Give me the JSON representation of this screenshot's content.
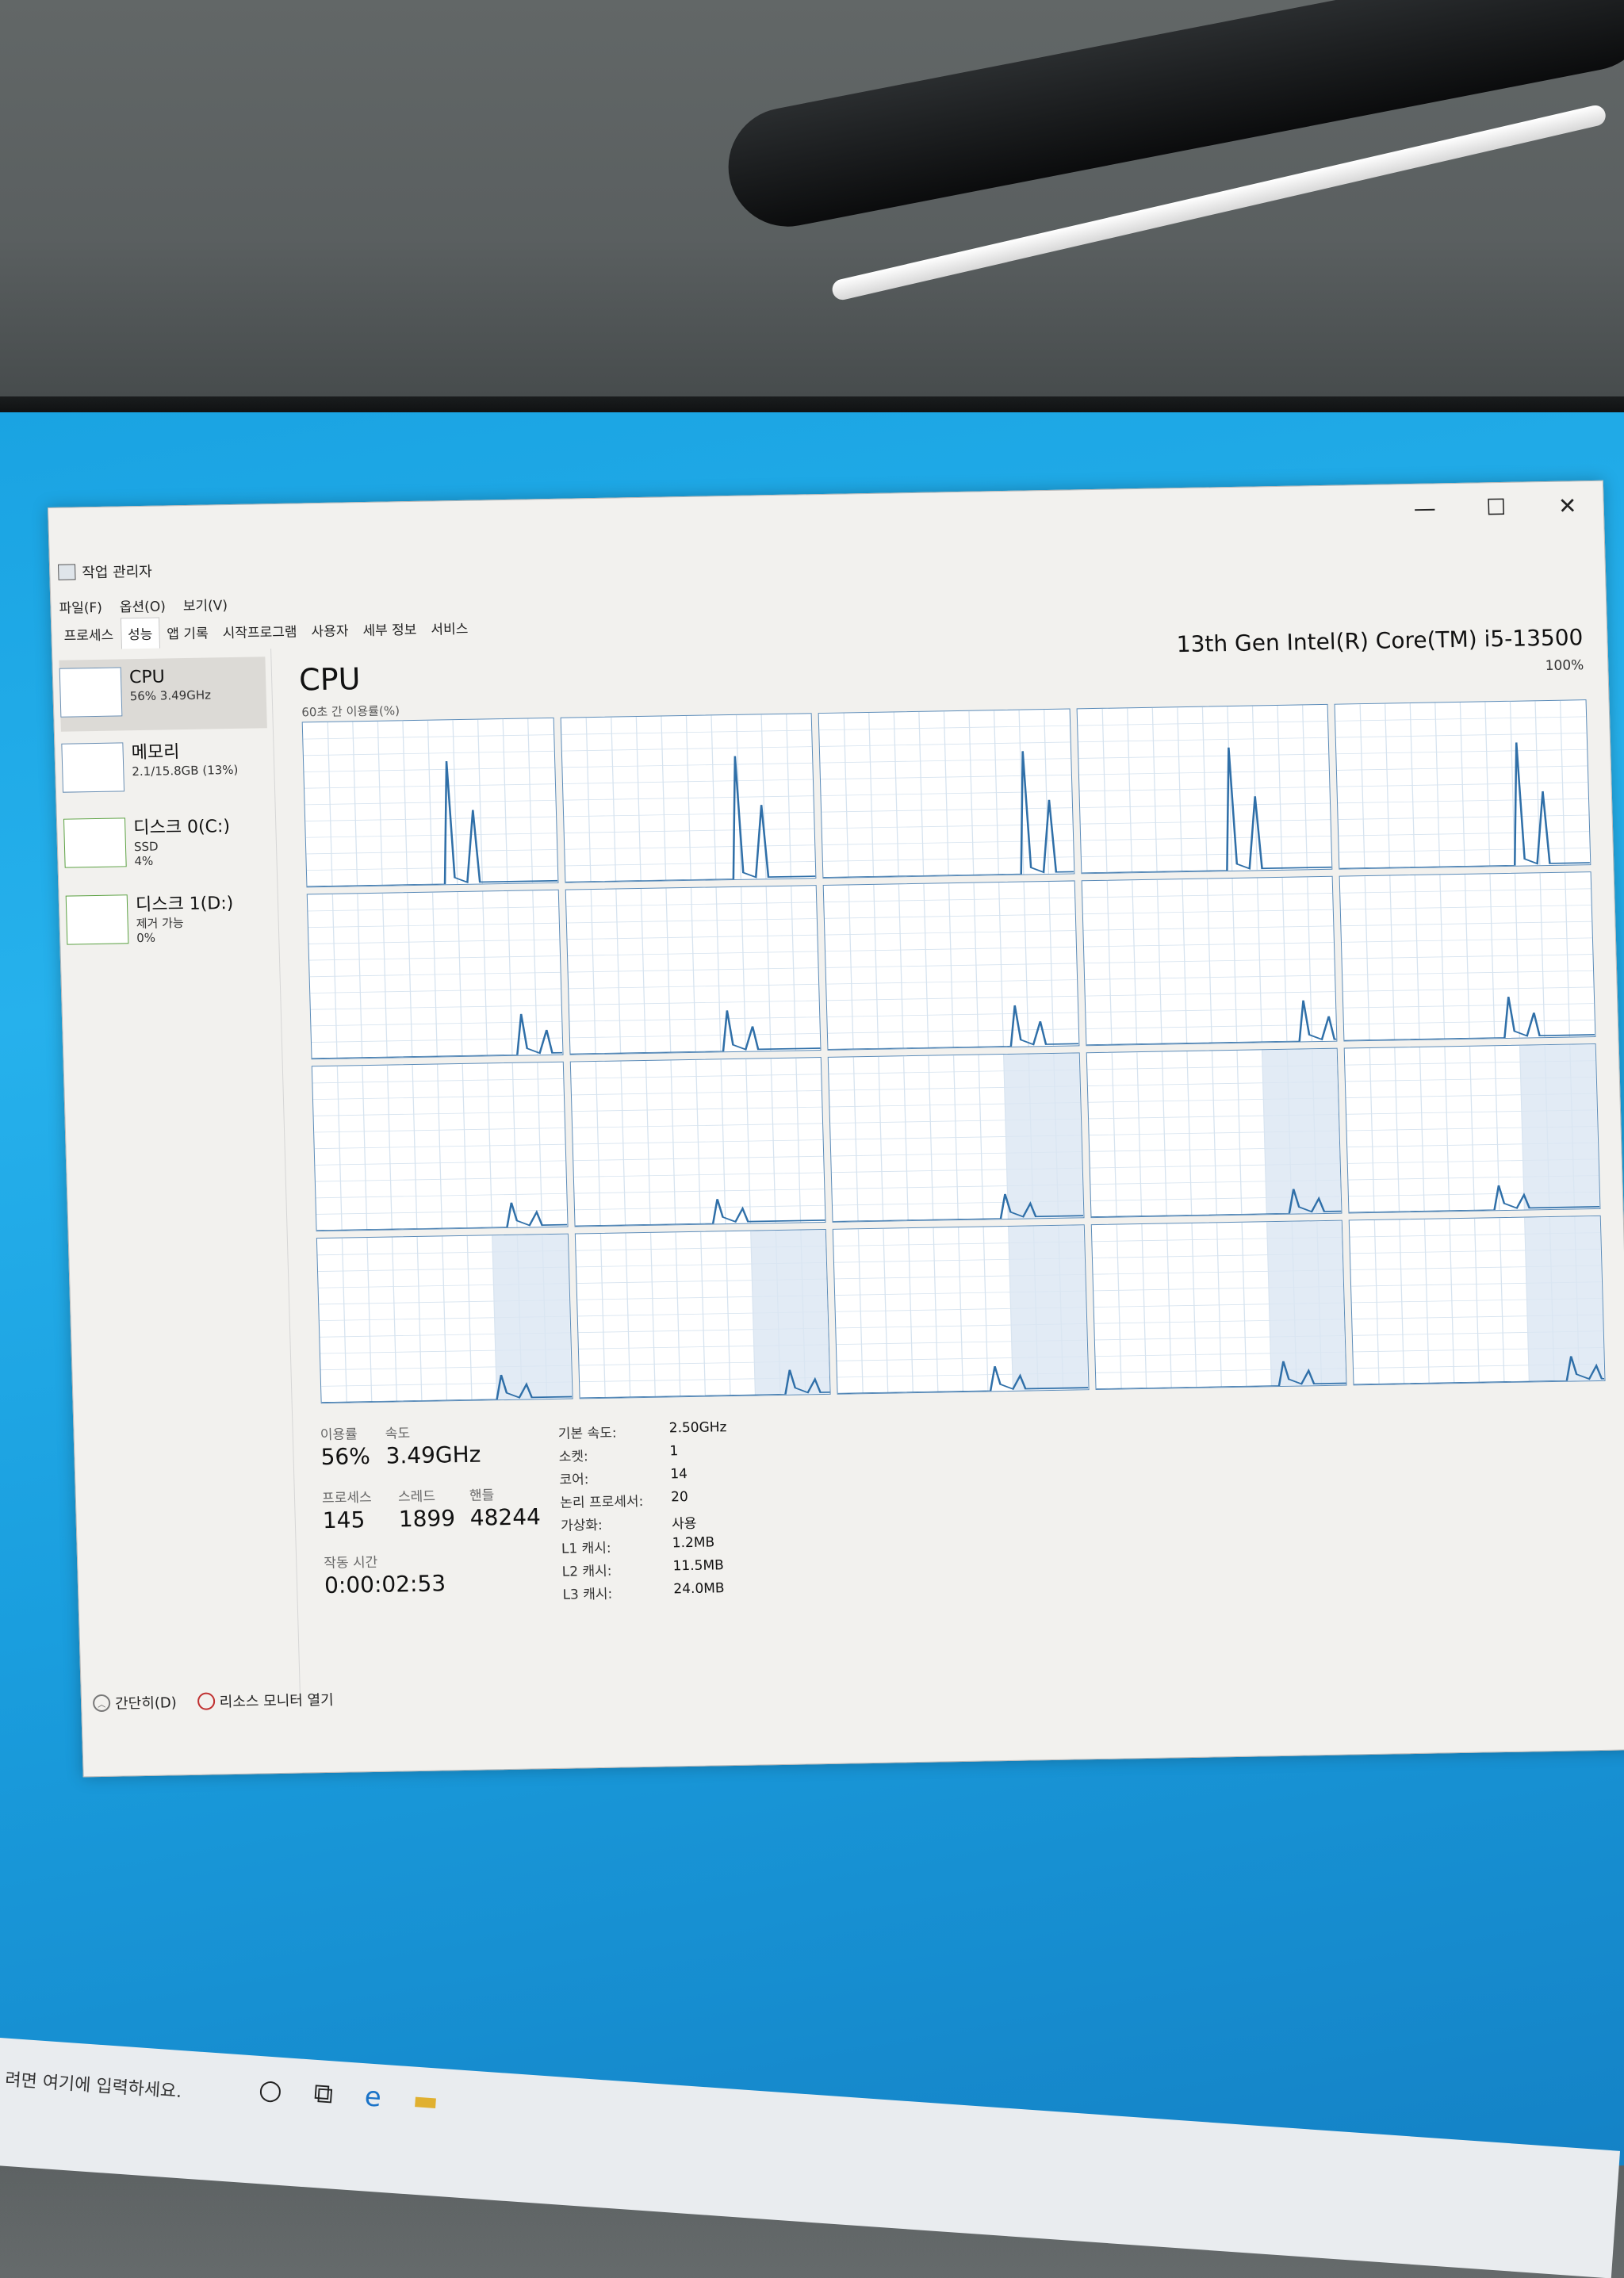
{
  "window": {
    "title": "작업 관리자",
    "controls": {
      "minimize": "—",
      "maximize": "☐",
      "close": "✕"
    }
  },
  "menu": [
    "파일(F)",
    "옵션(O)",
    "보기(V)"
  ],
  "tabs": [
    "프로세스",
    "성능",
    "앱 기록",
    "시작프로그램",
    "사용자",
    "세부 정보",
    "서비스"
  ],
  "active_tab": "성능",
  "sidebar": {
    "items": [
      {
        "name": "CPU",
        "sub1": "56% 3.49GHz",
        "sub2": "",
        "sub3": ""
      },
      {
        "name": "메모리",
        "sub1": "2.1/15.8GB (13%)",
        "sub2": "",
        "sub3": ""
      },
      {
        "name": "디스크 0(C:)",
        "sub1": "SSD",
        "sub2": "4%",
        "sub3": ""
      },
      {
        "name": "디스크 1(D:)",
        "sub1": "제거 가능",
        "sub2": "0%",
        "sub3": ""
      }
    ]
  },
  "main": {
    "title": "CPU",
    "model": "13th Gen Intel(R) Core(TM) i5-13500",
    "max_label": "100%",
    "util_label": "60초 간 이용률(%)",
    "logical_processor_graphs": 20
  },
  "stats": {
    "util_label": "이용률",
    "util_value": "56%",
    "speed_label": "속도",
    "speed_value": "3.49GHz",
    "proc_label": "프로세스",
    "proc_value": "145",
    "thread_label": "스레드",
    "thread_value": "1899",
    "handle_label": "핸들",
    "handle_value": "48244",
    "uptime_label": "작동 시간",
    "uptime_value": "0:00:02:53",
    "details": [
      {
        "k": "기본 속도:",
        "v": "2.50GHz"
      },
      {
        "k": "소켓:",
        "v": "1"
      },
      {
        "k": "코어:",
        "v": "14"
      },
      {
        "k": "논리 프로세서:",
        "v": "20"
      },
      {
        "k": "가상화:",
        "v": "사용"
      },
      {
        "k": "L1 캐시:",
        "v": "1.2MB"
      },
      {
        "k": "L2 캐시:",
        "v": "11.5MB"
      },
      {
        "k": "L3 캐시:",
        "v": "24.0MB"
      }
    ]
  },
  "footer": {
    "collapse": "간단히(D)",
    "resource_monitor": "리소스 모니터 열기"
  },
  "taskbar": {
    "search_placeholder": "려면 여기에 입력하세요."
  }
}
